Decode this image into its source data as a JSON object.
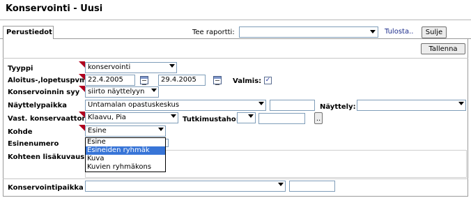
{
  "header": {
    "title": "Konservointi  - Uusi"
  },
  "tabs": [
    {
      "label": "Perustiedot"
    }
  ],
  "toolbar": {
    "report_label": "Tee raportti:",
    "report_value": "",
    "print_link": "Tulosta..",
    "close_label": "Sulje",
    "save_label": "Tallenna"
  },
  "form": {
    "tyyppi": {
      "label": "Tyyppi",
      "value": "konservointi"
    },
    "dates": {
      "label": "Aloitus-,lopetuspvm",
      "start": "22.4.2005",
      "end": "29.4.2005"
    },
    "valmis": {
      "label": "Valmis:",
      "checked": true,
      "mark": "✓"
    },
    "syy": {
      "label": "Konservoinnin syy",
      "value": "siirto näyttelyyn"
    },
    "nayttelypaikka": {
      "label": "Näyttelypaikka",
      "value": "Untamalan opastuskeskus",
      "extra": ""
    },
    "nayttely": {
      "label": "Näyttely:",
      "value": ""
    },
    "konservaattori": {
      "label": "Vast. konservaattori",
      "value": "Klaavu, Pia"
    },
    "tutkimustaho": {
      "label": "Tutkimustaho:",
      "value": "",
      "extra": "",
      "button": ".."
    },
    "kohde": {
      "label": "Kohde",
      "value": "Esine",
      "options": [
        "Esine",
        "Esineiden ryhmäk",
        "Kuva",
        "Kuvien ryhmäkons"
      ],
      "highlighted_index": 1
    },
    "esinenumero": {
      "label": "Esinenumero"
    },
    "lisakuvaus": {
      "label": "Kohteen lisäkuvaus",
      "value": ""
    },
    "konservointipaikka": {
      "label": "Konservointipaikka",
      "value": "",
      "extra": ""
    }
  },
  "colors": {
    "required_marker": "#b0001e",
    "highlight": "#3875d7",
    "link": "#1a2a8a"
  }
}
